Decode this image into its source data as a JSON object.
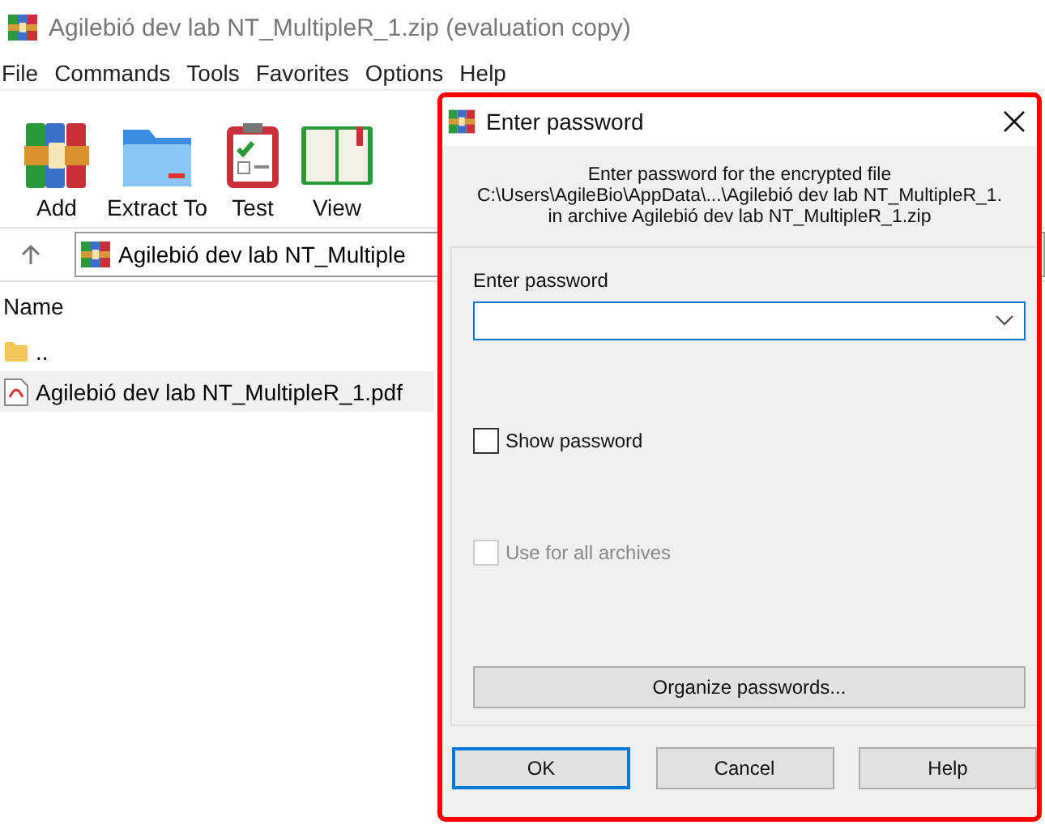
{
  "window": {
    "title": "Agilebió dev lab NT_MultipleR_1.zip (evaluation copy)"
  },
  "menu": [
    "File",
    "Commands",
    "Tools",
    "Favorites",
    "Options",
    "Help"
  ],
  "toolbar": [
    {
      "label": "Add",
      "kind": "archive"
    },
    {
      "label": "Extract To",
      "kind": "folder"
    },
    {
      "label": "Test",
      "kind": "clipboard"
    },
    {
      "label": "View",
      "kind": "book"
    }
  ],
  "address": {
    "value": "Agilebió dev lab NT_Multiple"
  },
  "file_list": {
    "columns": [
      "Name"
    ],
    "rows": [
      {
        "name": "..",
        "kind": "folder",
        "selected": false
      },
      {
        "name": "Agilebió dev lab NT_MultipleR_1.pdf",
        "kind": "pdf",
        "selected": true
      }
    ]
  },
  "dialog": {
    "title": "Enter password",
    "message": [
      "Enter password for the encrypted file",
      "C:\\Users\\AgileBio\\AppData\\...\\Agilebió dev lab NT_MultipleR_1.",
      "in archive Agilebió dev lab NT_MultipleR_1.zip"
    ],
    "field_label": "Enter password",
    "checkboxes": [
      {
        "label": "Show password",
        "checked": false,
        "disabled": false
      },
      {
        "label": "Use for all archives",
        "checked": false,
        "disabled": true
      }
    ],
    "organize_button": "Organize passwords...",
    "buttons": [
      {
        "label": "OK",
        "selected": true
      },
      {
        "label": "Cancel",
        "selected": false
      },
      {
        "label": "Help",
        "selected": false
      }
    ]
  }
}
